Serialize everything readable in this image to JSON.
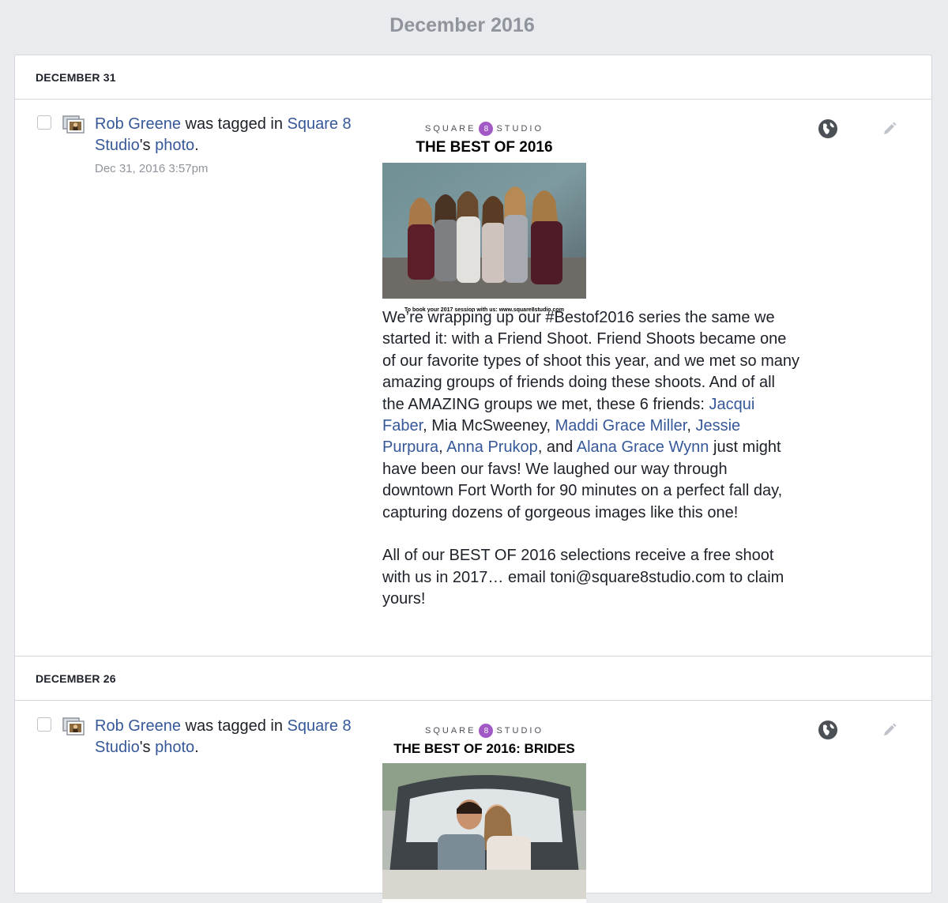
{
  "month_title": "December 2016",
  "sections": [
    {
      "date": "DECEMBER 31",
      "entry": {
        "actor": "Rob Greene",
        "action": " was tagged in ",
        "page": "Square 8 Studio",
        "possessive": "'s ",
        "object": "photo",
        "period": ".",
        "timestamp": "Dec 31, 2016 3:57pm",
        "brand_left": "SQUARE",
        "brand_right": "STUDIO",
        "brand_badge": "8",
        "image_title": "THE BEST OF 2016",
        "image_caption": "To book your 2017 session with us: www.square8studio.com",
        "post_text": [
          {
            "t": "We’re wrapping up our #Bestof2016 series the same we started it: with a Friend Shoot. Friend Shoots became one of our favorite types of shoot this year, and we met so many amazing groups of friends doing these shoots. And of all the AMAZING groups we met, these 6 friends: "
          },
          {
            "t": "Jacqui Faber",
            "link": true
          },
          {
            "t": ", Mia McSweeney, "
          },
          {
            "t": "Maddi Grace Miller",
            "link": true
          },
          {
            "t": ", "
          },
          {
            "t": "Jessie Purpura",
            "link": true
          },
          {
            "t": ", "
          },
          {
            "t": "Anna Prukop",
            "link": true
          },
          {
            "t": ", and "
          },
          {
            "t": "Alana Grace Wynn",
            "link": true
          },
          {
            "t": " just might have been our favs! We laughed our way through downtown Fort Worth for 90 minutes on a perfect fall day, capturing dozens of gorgeous images like this one!\n\nAll of our BEST OF 2016 selections receive a free shoot with us in 2017… email toni@square8studio.com to claim yours!"
          }
        ]
      }
    },
    {
      "date": "DECEMBER 26",
      "entry": {
        "actor": "Rob Greene",
        "action": " was tagged in ",
        "page": "Square 8 Studio",
        "possessive": "'s ",
        "object": "photo",
        "period": ".",
        "brand_left": "SQUARE",
        "brand_right": "STUDIO",
        "brand_badge": "8",
        "image_title": "THE BEST OF 2016: BRIDES"
      }
    }
  ],
  "icons": {
    "checkbox": "checkbox-icon",
    "photo": "photo-tag-icon",
    "audience": "globe-icon",
    "edit": "pencil-icon"
  },
  "colors": {
    "link": "#365899",
    "background": "#e9ebee",
    "muted": "#90949c",
    "brand_badge": "#a259c6"
  }
}
